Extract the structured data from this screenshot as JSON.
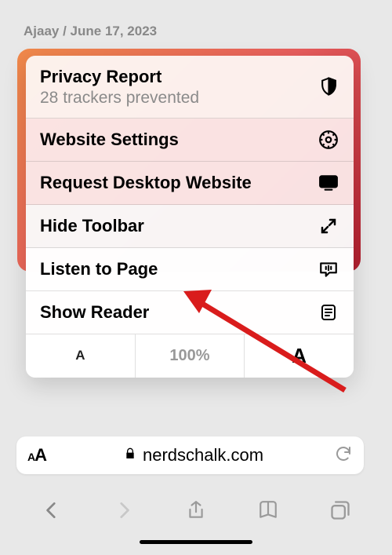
{
  "byline": {
    "author": "Ajaay",
    "separator": " / ",
    "date": "June 17, 2023"
  },
  "menu": {
    "privacyReport": {
      "title": "Privacy Report",
      "subtitle": "28 trackers prevented"
    },
    "websiteSettings": "Website Settings",
    "requestDesktop": "Request Desktop Website",
    "hideToolbar": "Hide Toolbar",
    "listenToPage": "Listen to Page",
    "showReader": "Show Reader",
    "zoom": {
      "decrease": "A",
      "level": "100%",
      "increase": "A"
    }
  },
  "addressBar": {
    "domain": "nerdschalk.com"
  },
  "colors": {
    "annotationArrow": "#d91c1c"
  }
}
